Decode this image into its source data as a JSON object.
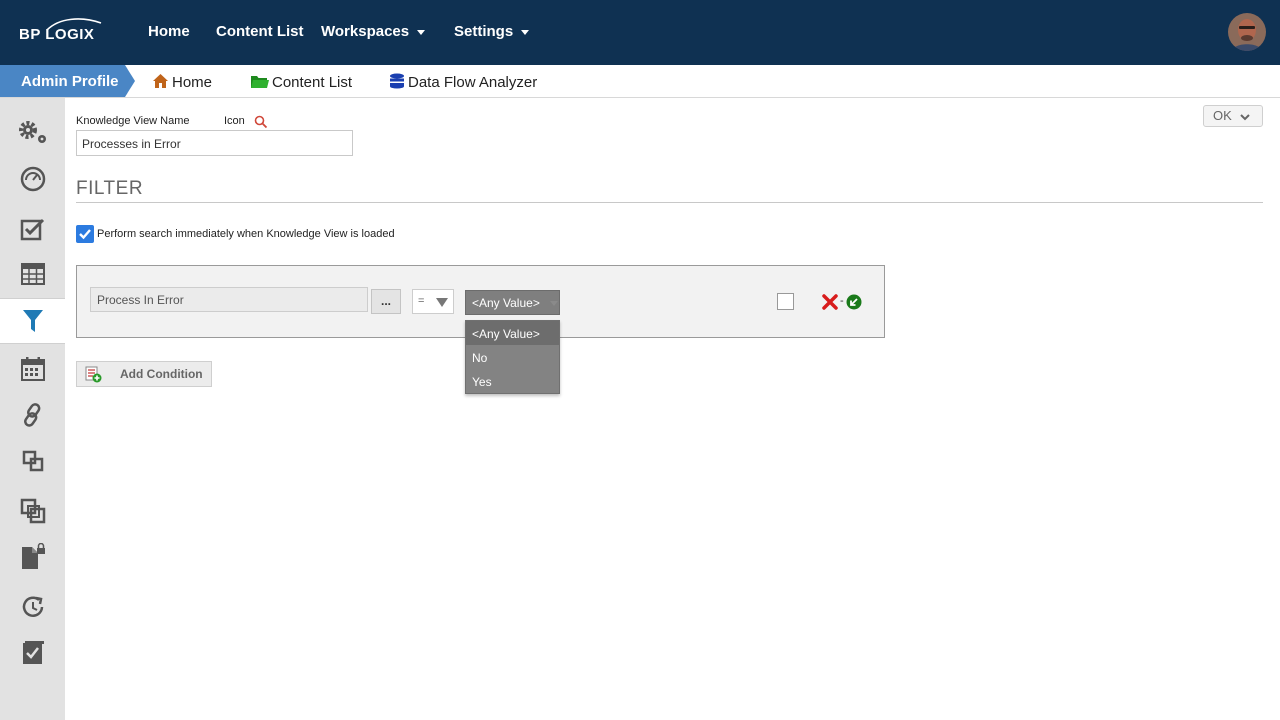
{
  "app": {
    "logo_text": "BP LOGIX",
    "brand_color": "#0f3152"
  },
  "topnav": {
    "items": [
      {
        "label": "Home"
      },
      {
        "label": "Content List"
      },
      {
        "label": "Workspaces",
        "has_dropdown": true
      },
      {
        "label": "Settings",
        "has_dropdown": true
      }
    ],
    "avatar_icon": "user-avatar"
  },
  "breadcrumb": {
    "active": "Admin Profile",
    "items": [
      {
        "label": "Home",
        "icon": "home-icon"
      },
      {
        "label": "Content List",
        "icon": "folder-icon"
      },
      {
        "label": "Data Flow Analyzer",
        "icon": "database-icon"
      }
    ]
  },
  "sidebar": {
    "items": [
      {
        "icon": "gears-icon"
      },
      {
        "icon": "dashboard-gauge-icon"
      },
      {
        "icon": "checklist-icon"
      },
      {
        "icon": "table-icon"
      },
      {
        "icon": "filter-icon",
        "active": true
      },
      {
        "icon": "calendar-icon"
      },
      {
        "icon": "link-icon"
      },
      {
        "icon": "layers-icon"
      },
      {
        "icon": "copy-icon"
      },
      {
        "icon": "locked-document-icon"
      },
      {
        "icon": "refresh-clock-icon"
      },
      {
        "icon": "checked-clipboard-icon"
      }
    ]
  },
  "form": {
    "name_label": "Knowledge View Name",
    "icon_label": "Icon",
    "name_value": "Processes in Error",
    "ok_label": "OK",
    "filter_heading": "FILTER",
    "perform_search_label": "Perform search immediately when Knowledge View is loaded",
    "perform_search_checked": true
  },
  "condition": {
    "field_value": "Process In Error",
    "browse_label": "...",
    "operator": "=",
    "value_selected": "<Any Value>",
    "options": [
      "<Any Value>",
      "No",
      "Yes"
    ],
    "row_checked": false,
    "dash": "-"
  },
  "add_condition_label": "Add Condition"
}
